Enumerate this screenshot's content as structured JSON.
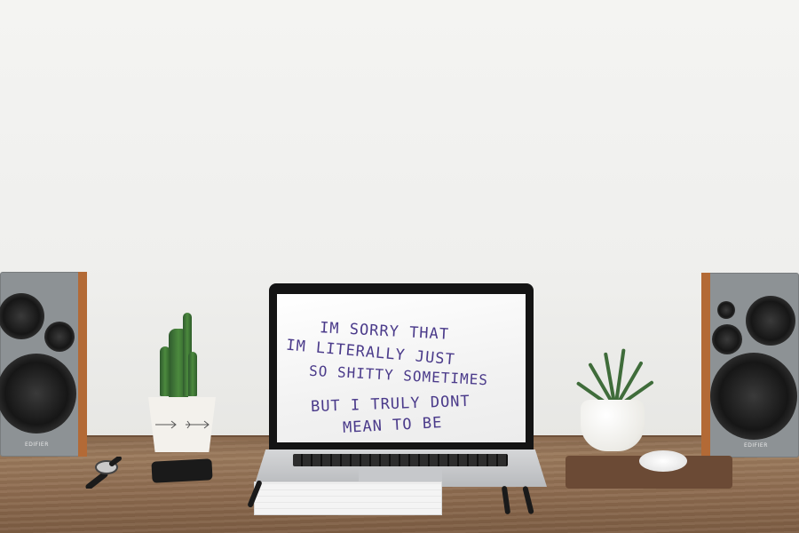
{
  "scene": {
    "note_lines": [
      "IM SORRY THAT",
      "IM LITERALLY JUST",
      "SO SHITTY SOMETIMES",
      "BUT I TRULY DONT",
      "MEAN TO BE"
    ],
    "speaker_brand": "EDIFIER",
    "colors": {
      "wall": "#efefed",
      "desk": "#8e6c50",
      "ink": "#4a3a8a",
      "speaker_grey": "#8d9295",
      "speaker_wood": "#b36a36"
    }
  }
}
